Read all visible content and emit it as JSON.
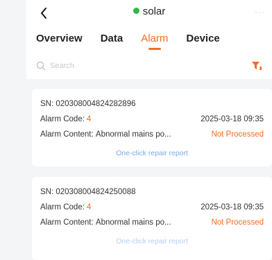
{
  "header": {
    "back_icon": "chevron-left-icon",
    "title": "solar",
    "status_color": "#2fb84a",
    "more_label": "···"
  },
  "tabs": [
    {
      "label": "Overview",
      "active": false
    },
    {
      "label": "Data",
      "active": false
    },
    {
      "label": "Alarm",
      "active": true
    },
    {
      "label": "Device",
      "active": false
    }
  ],
  "search": {
    "placeholder": "Search",
    "filter_icon": "filter-icon",
    "accent": "#f36c21"
  },
  "alarms": [
    {
      "sn_label": "SN:",
      "sn": "020308004824282896",
      "code_label": "Alarm Code:",
      "code": "4",
      "date": "2025-03-18 09:35",
      "content_label": "Alarm Content:",
      "content": "Abnormal mains po...",
      "status": "Not Processed",
      "action": "One-click repair report"
    },
    {
      "sn_label": "SN:",
      "sn": "020308004824250088",
      "code_label": "Alarm Code:",
      "code": "4",
      "date": "2025-03-18 09:35",
      "content_label": "Alarm Content:",
      "content": "Abnormal mains po...",
      "status": "Not Processed",
      "action": "One-click repair report"
    }
  ]
}
